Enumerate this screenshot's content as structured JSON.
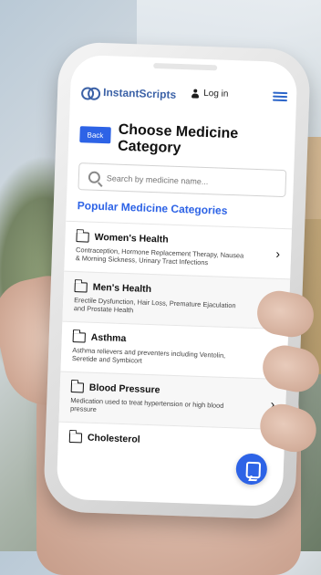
{
  "navbar": {
    "brand": "InstantScripts",
    "login_label": "Log in"
  },
  "page": {
    "back_label": "Back",
    "title": "Choose Medicine Category"
  },
  "search": {
    "placeholder": "Search by medicine name..."
  },
  "section": {
    "title": "Popular Medicine Categories"
  },
  "categories": [
    {
      "title": "Women's Health",
      "description": "Contraception, Hormone Replacement Therapy, Nausea & Morning Sickness, Urinary Tract Infections"
    },
    {
      "title": "Men's Health",
      "description": "Erectile Dysfunction, Hair Loss, Premature Ejaculation and Prostate Health"
    },
    {
      "title": "Asthma",
      "description": "Asthma relievers and preventers including Ventolin, Seretide and Symbicort"
    },
    {
      "title": "Blood Pressure",
      "description": "Medication used to treat hypertension or high blood pressure"
    },
    {
      "title": "Cholesterol",
      "description": ""
    }
  ],
  "icons": {
    "logo": "instantscripts-logo-icon",
    "user": "user-icon",
    "menu": "hamburger-menu-icon",
    "search": "search-icon",
    "category": "folder-icon",
    "chevron": "chevron-right-icon",
    "chat": "chat-icon"
  },
  "colors": {
    "accent": "#2d63e6",
    "brand": "#3c62a7"
  }
}
